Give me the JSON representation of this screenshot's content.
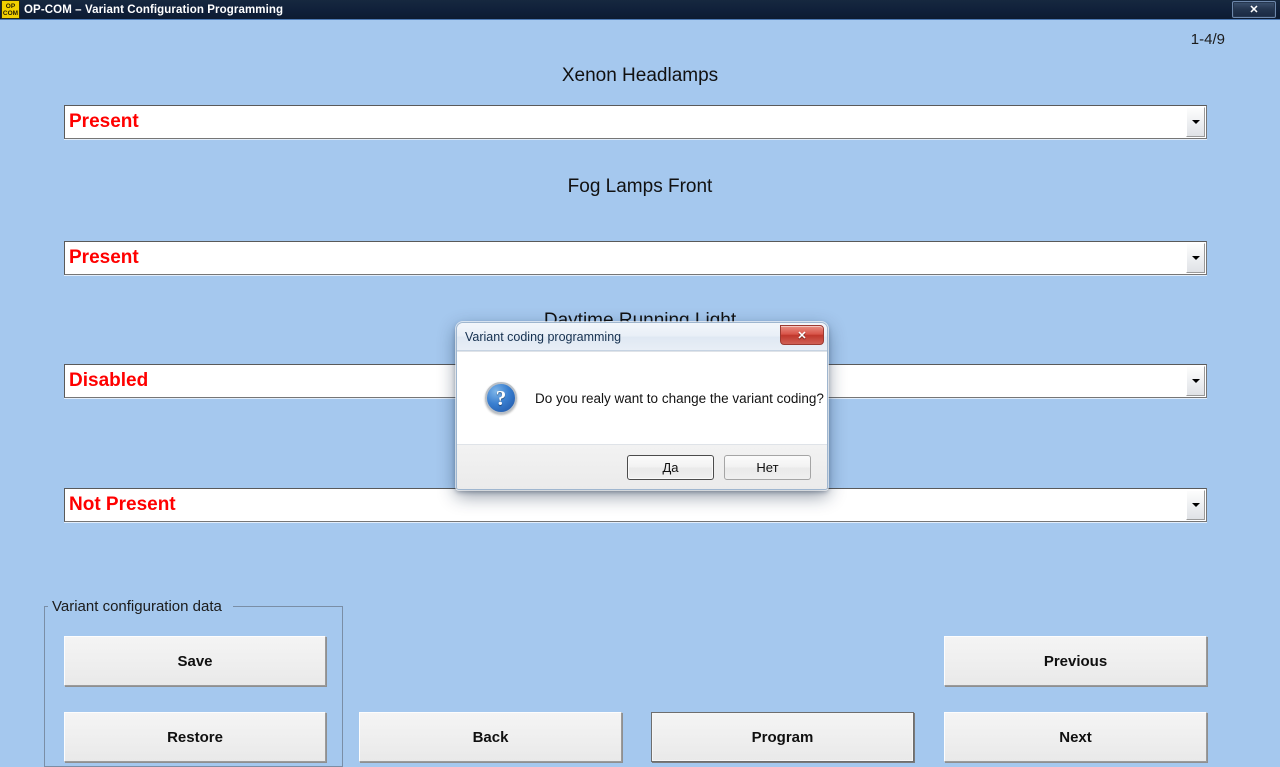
{
  "window": {
    "title": "OP-COM – Variant Configuration Programming",
    "logo_top": "OP",
    "logo_bottom": "COM",
    "close_label": "✕",
    "close_icon": "close-icon"
  },
  "page_counter": "1-4/9",
  "fields": [
    {
      "label": "Xenon Headlamps",
      "value": "Present"
    },
    {
      "label": "Fog Lamps Front",
      "value": "Present"
    },
    {
      "label": "Daytime Running Light",
      "value": "Disabled"
    },
    {
      "label": "",
      "value": "Not Present"
    }
  ],
  "groupbox": {
    "title": "Variant configuration data",
    "save_label": "Save",
    "restore_label": "Restore"
  },
  "nav": {
    "back_label": "Back",
    "program_label": "Program",
    "previous_label": "Previous",
    "next_label": "Next"
  },
  "dialog": {
    "title": "Variant coding programming",
    "close_label": "✕",
    "icon": "question-icon",
    "icon_glyph": "?",
    "message": "Do you realy want to change the variant coding?",
    "yes_label": "Да",
    "no_label": "Нет"
  },
  "colors": {
    "background": "#a5c8ee",
    "titlebar": "#10203a",
    "logo": "#f2d000",
    "value_text": "#ff0000",
    "dialog_close": "#c0372c"
  }
}
